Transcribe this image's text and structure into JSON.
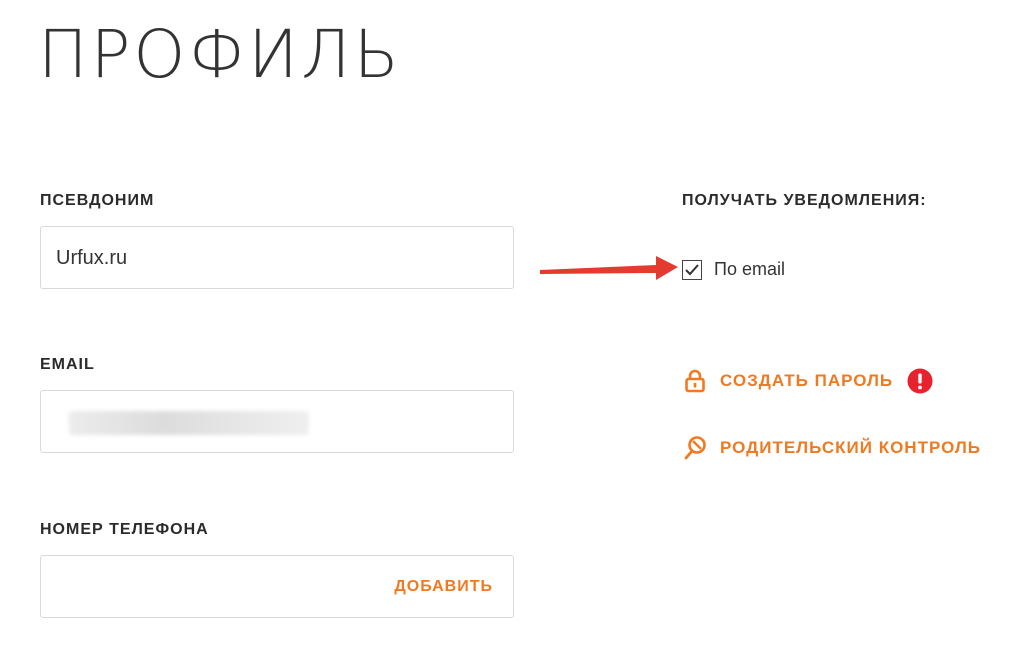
{
  "page": {
    "title": "ПРОФИЛЬ"
  },
  "profile": {
    "nickname": {
      "label": "ПСЕВДОНИМ",
      "value": "Urfux.ru"
    },
    "email": {
      "label": "EMAIL"
    },
    "phone": {
      "label": "НОМЕР ТЕЛЕФОНА",
      "add_label": "ДОБАВИТЬ"
    }
  },
  "notifications": {
    "label": "ПОЛУЧАТЬ УВЕДОМЛЕНИЯ:",
    "email_option": {
      "label": "По email",
      "checked": true
    }
  },
  "actions": {
    "create_password": "СОЗДАТЬ ПАРОЛЬ",
    "parental_control": "РОДИТЕЛЬСКИЙ КОНТРОЛЬ"
  },
  "colors": {
    "accent": "#ef7a22",
    "alert": "#e8212e",
    "arrow": "#e33b2f"
  }
}
